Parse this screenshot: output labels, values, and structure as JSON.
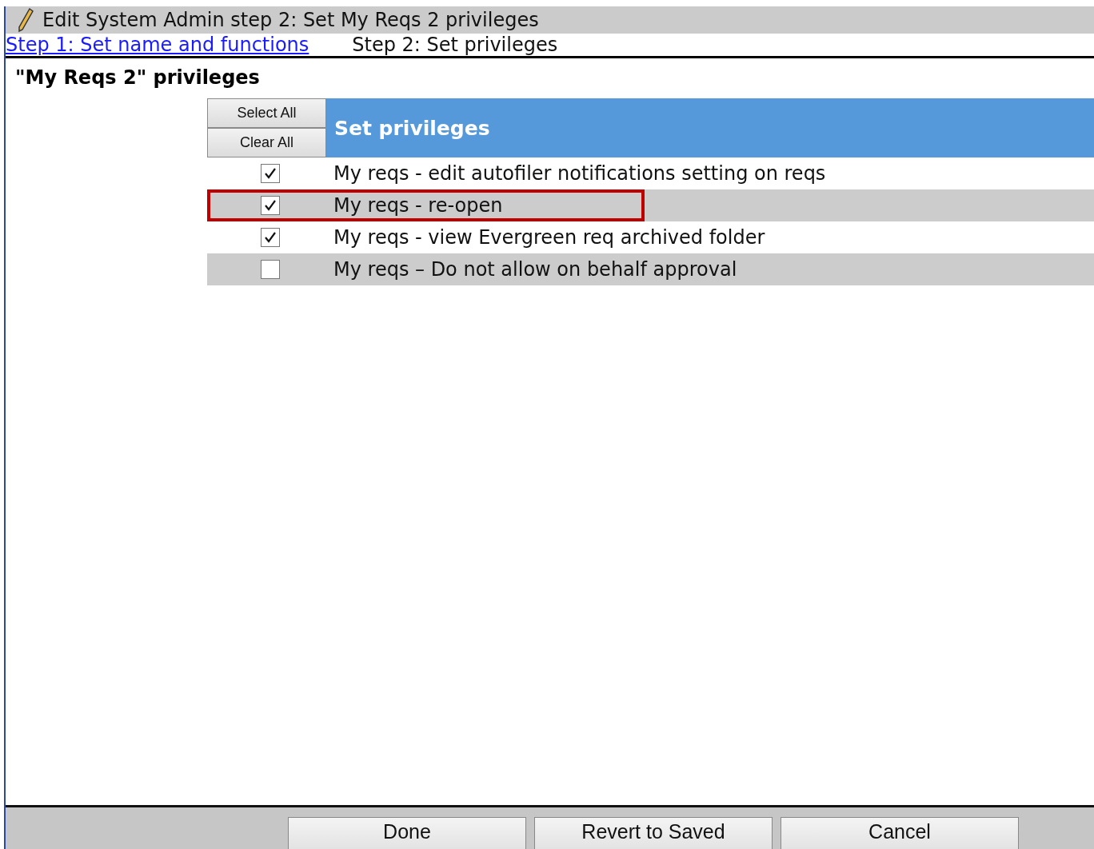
{
  "window": {
    "title": "Edit System Admin step 2: Set My Reqs 2 privileges"
  },
  "steps": [
    {
      "label": "Step 1: Set name and functions",
      "kind": "link"
    },
    {
      "label": "Step 2: Set privileges",
      "kind": "current"
    }
  ],
  "heading": "\"My Reqs 2\" privileges",
  "table": {
    "select_all": "Select All",
    "clear_all": "Clear All",
    "title": "Set privileges",
    "rows": [
      {
        "label": "My reqs - edit autofiler notifications setting on reqs",
        "checked": true,
        "highlighted": false
      },
      {
        "label": "My reqs - re-open",
        "checked": true,
        "highlighted": true
      },
      {
        "label": "My reqs - view Evergreen req archived folder",
        "checked": true,
        "highlighted": false
      },
      {
        "label": "My reqs – Do not allow on behalf approval",
        "checked": false,
        "highlighted": false
      }
    ]
  },
  "buttons": [
    "Done",
    "Revert to Saved",
    "Cancel"
  ]
}
